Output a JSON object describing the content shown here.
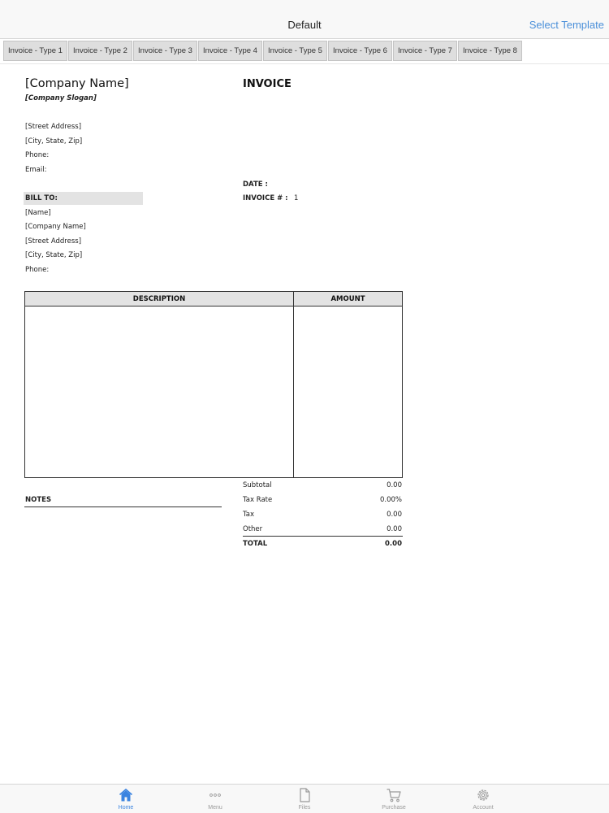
{
  "navbar": {
    "title": "Default",
    "action_label": "Select Template"
  },
  "template_tabs": [
    "Invoice - Type 1",
    "Invoice - Type 2",
    "Invoice - Type 3",
    "Invoice - Type 4",
    "Invoice - Type 5",
    "Invoice - Type 6",
    "Invoice - Type 7",
    "Invoice - Type 8"
  ],
  "invoice": {
    "company_name": "[Company Name]",
    "company_slogan": "[Company Slogan]",
    "title": "INVOICE",
    "street_address": "[Street Address]",
    "city_state_zip": "[City, State,  Zip]",
    "phone_label": "Phone:",
    "email_label": "Email:",
    "date_label": "DATE :",
    "invoice_number_label": "INVOICE # :",
    "invoice_number": "1",
    "bill_to": {
      "heading": "BILL TO:",
      "name": "[Name]",
      "company_name": "[Company Name]",
      "street_address": "[Street Address]",
      "city_state_zip": "[City, State,  Zip]",
      "phone_label": "Phone:"
    },
    "table": {
      "description_header": "DESCRIPTION",
      "amount_header": "AMOUNT"
    },
    "notes_label": "NOTES",
    "totals": {
      "subtotal_label": "Subtotal",
      "subtotal": "0.00",
      "tax_rate_label": "Tax Rate",
      "tax_rate": "0.00%",
      "tax_label": "Tax",
      "tax": "0.00",
      "other_label": "Other",
      "other": "0.00",
      "total_label": "TOTAL",
      "total": "0.00"
    }
  },
  "tabbar": {
    "items": [
      {
        "label": "Home",
        "icon": "home-icon",
        "active": true
      },
      {
        "label": "Menu",
        "icon": "more-icon",
        "active": false
      },
      {
        "label": "Files",
        "icon": "file-icon",
        "active": false
      },
      {
        "label": "Purchase",
        "icon": "cart-icon",
        "active": false
      },
      {
        "label": "Account",
        "icon": "gear-icon",
        "active": false
      }
    ],
    "active_color": "#3b84e0",
    "inactive_color": "#999999"
  }
}
